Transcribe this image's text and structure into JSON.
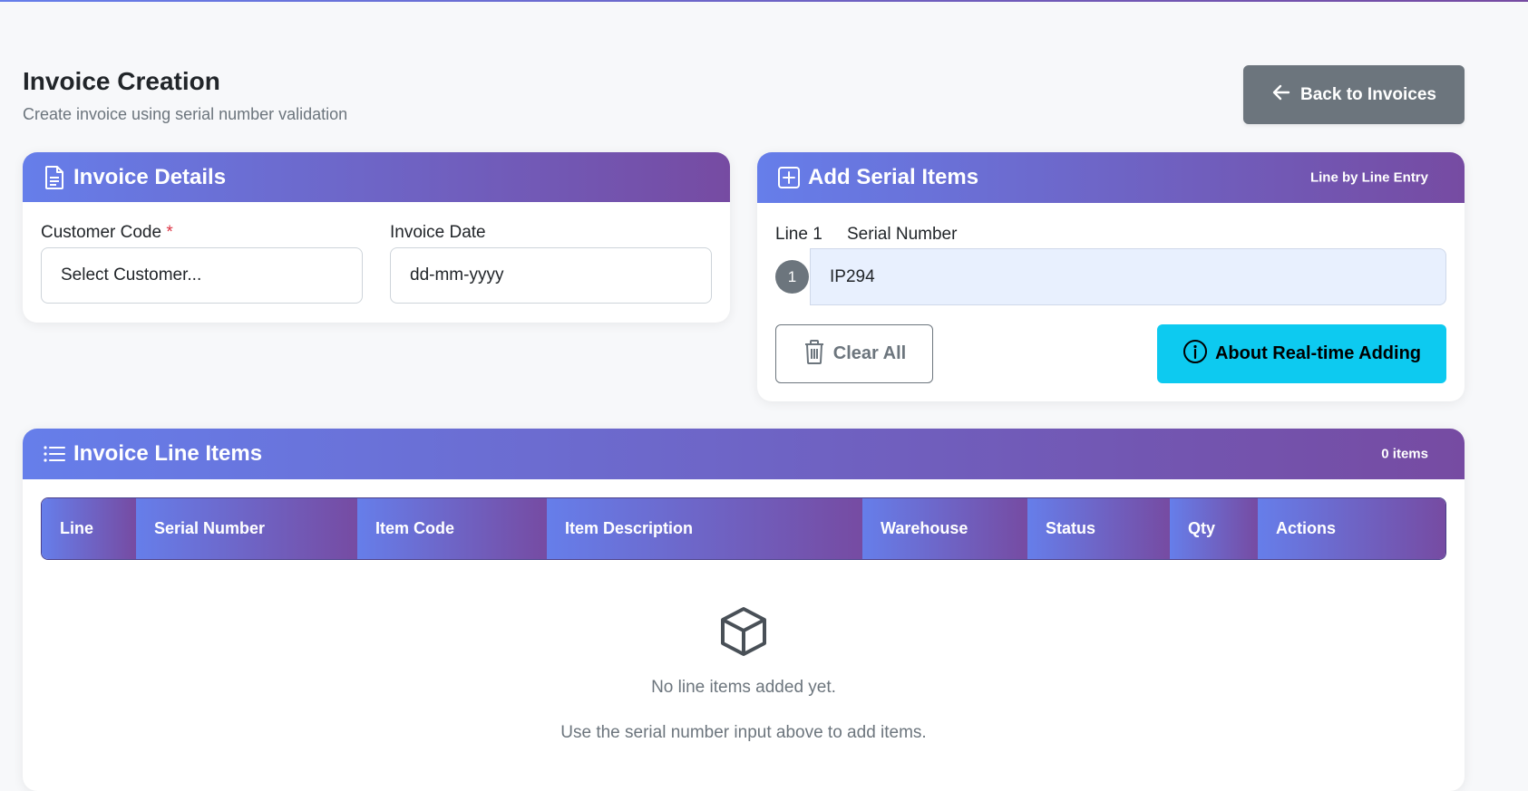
{
  "page": {
    "title": "Invoice Creation",
    "subtitle": "Create invoice using serial number validation",
    "back_label": "Back to Invoices"
  },
  "invoice_details": {
    "title": "Invoice Details",
    "customer_label": "Customer Code",
    "required_marker": "*",
    "customer_value": "Select Customer...",
    "date_label": "Invoice Date",
    "date_value": "dd-mm-yyyy"
  },
  "serial_items": {
    "title": "Add Serial Items",
    "mode_badge": "Line by Line Entry",
    "line_label": "Line 1",
    "serial_label": "Serial Number",
    "line_number": "1",
    "serial_value": "IP294",
    "clear_label": "Clear All",
    "about_label": "About Real-time Adding"
  },
  "line_items": {
    "title": "Invoice Line Items",
    "count_badge": "0 items",
    "columns": [
      "Line",
      "Serial Number",
      "Item Code",
      "Item Description",
      "Warehouse",
      "Status",
      "Qty",
      "Actions"
    ],
    "empty_title": "No line items added yet.",
    "empty_hint": "Use the serial number input above to add items."
  },
  "icons": {
    "back": "arrow-left-icon",
    "details": "document-icon",
    "add": "plus-square-icon",
    "list": "list-icon",
    "trash": "trash-icon",
    "info": "info-circle-icon",
    "empty": "box-icon"
  },
  "colors": {
    "gradient_start": "#667eea",
    "gradient_end": "#764ba2",
    "secondary": "#6c757d",
    "info": "#0dcaf0",
    "input_highlight": "#e8f0fe",
    "required": "#dc3545"
  }
}
